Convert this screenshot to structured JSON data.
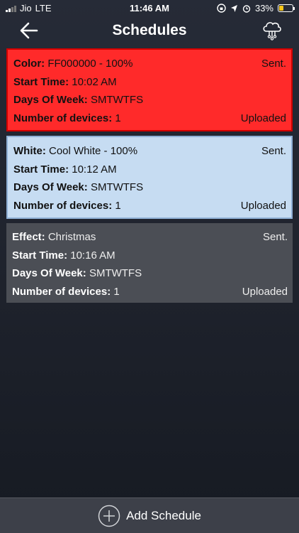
{
  "status_bar": {
    "carrier": "Jio",
    "network": "LTE",
    "time": "11:46 AM",
    "battery": "33%"
  },
  "header": {
    "title": "Schedules"
  },
  "schedules": [
    {
      "label_primary": "Color:",
      "value_primary": "FF000000 - 100%",
      "status": "Sent.",
      "start_label": "Start Time:",
      "start_time": "10:02 AM",
      "days_label": "Days Of Week:",
      "days": "SMTWTFS",
      "devices_label": "Number of devices:",
      "devices": "1",
      "upload_status": "Uploaded",
      "color": "#ff2a2a"
    },
    {
      "label_primary": "White:",
      "value_primary": "Cool White - 100%",
      "status": "Sent.",
      "start_label": "Start Time:",
      "start_time": "10:12 AM",
      "days_label": "Days Of Week:",
      "days": "SMTWTFS",
      "devices_label": "Number of devices:",
      "devices": "1",
      "upload_status": "Uploaded",
      "color": "#c6dcf2"
    },
    {
      "label_primary": "Effect:",
      "value_primary": "Christmas",
      "status": "Sent.",
      "start_label": "Start Time:",
      "start_time": "10:16 AM",
      "days_label": "Days Of Week:",
      "days": "SMTWTFS",
      "devices_label": "Number of devices:",
      "devices": "1",
      "upload_status": "Uploaded",
      "color": "#4b4e55"
    }
  ],
  "footer": {
    "add_label": "Add Schedule",
    "icon": "plus-circle-icon"
  },
  "icons": {
    "back": "arrow-left-icon",
    "cloud": "cloud-network-icon"
  }
}
